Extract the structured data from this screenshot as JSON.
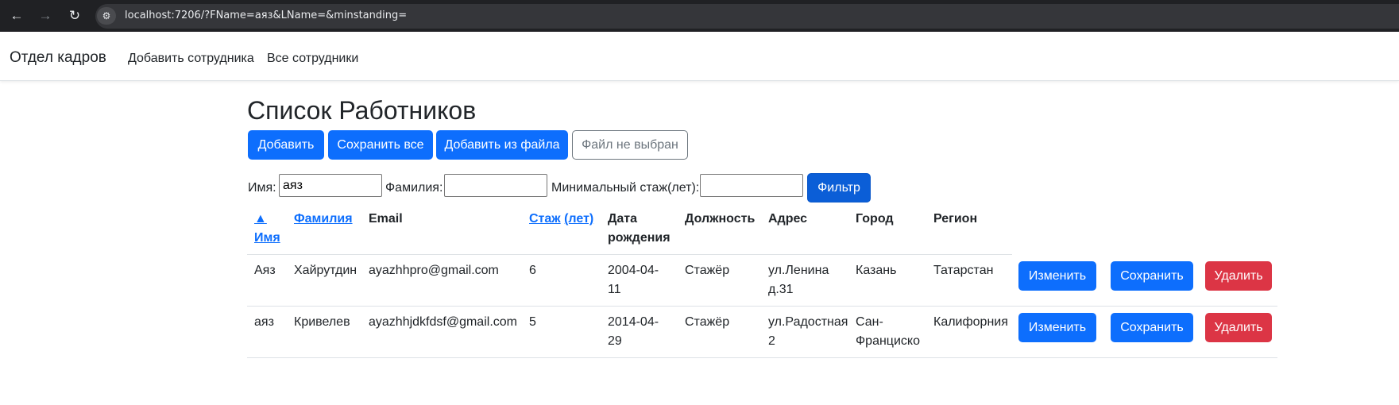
{
  "browser": {
    "url": "localhost:7206/?FName=аяз&LName=&minstanding=",
    "back_icon": "←",
    "forward_icon": "→",
    "reload_icon": "↻",
    "site_info_icon": "⚙"
  },
  "navbar": {
    "brand": "Отдел кадров",
    "links": [
      "Добавить сотрудника",
      "Все сотрудники"
    ]
  },
  "main": {
    "title": "Список Работников",
    "buttons": {
      "add": "Добавить",
      "save_all": "Сохранить все",
      "add_from_file": "Добавить из файла",
      "file_input": "Файл не выбран"
    },
    "filter": {
      "first_name_label": "Имя:",
      "first_name_value": "аяз",
      "last_name_label": "Фамилия:",
      "last_name_value": "",
      "min_standing_label": "Минимальный стаж(лет):",
      "min_standing_value": "",
      "button": "Фильтр"
    },
    "table": {
      "headers": {
        "name_arrow": "▲",
        "name": "Имя",
        "surname": "Фамилия",
        "email": "Email",
        "standing_link": "Стаж",
        "standing_unit": "(лет)",
        "birth_line1": "Дата",
        "birth_line2": "рождения",
        "position": "Должность",
        "address": "Адрес",
        "city": "Город",
        "region": "Регион"
      },
      "rows": [
        {
          "name": "Аяз",
          "surname": "Хайрутдин",
          "email": "ayazhhpro@gmail.com",
          "standing": "6",
          "birth_line1": "2004-04-",
          "birth_line2": "11",
          "position": "Стажёр",
          "address_line1": "ул.Ленина",
          "address_line2": "д.31",
          "city_line1": "Казань",
          "city_line2": "",
          "region": "Татарстан",
          "edit": "Изменить",
          "save": "Сохранить",
          "delete": "Удалить"
        },
        {
          "name": "аяз",
          "surname": "Кривелев",
          "email": "ayazhhjdkfdsf@gmail.com",
          "standing": "5",
          "birth_line1": "2014-04-",
          "birth_line2": "29",
          "position": "Стажёр",
          "address_line1": "ул.Радостная",
          "address_line2": "2",
          "city_line1": "Сан-",
          "city_line2": "Франциско",
          "region": "Калифорния",
          "edit": "Изменить",
          "save": "Сохранить",
          "delete": "Удалить"
        }
      ]
    }
  },
  "colors": {
    "primary": "#0d6efd",
    "danger": "#dc3545",
    "browser_bar": "#202124"
  }
}
